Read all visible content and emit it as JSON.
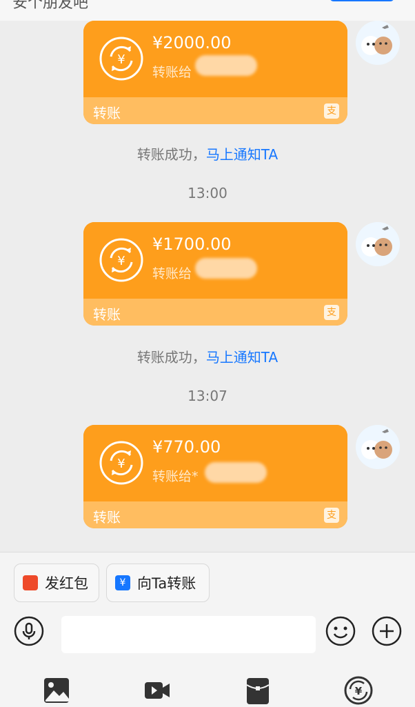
{
  "header": {
    "partial_text": "安个朋友吧"
  },
  "messages": [
    {
      "amount": "¥2000.00",
      "to": "转账给",
      "label": "转账",
      "notice": "转账成功，",
      "notice_link": "马上通知TA"
    },
    {
      "time": "13:00",
      "amount": "¥1700.00",
      "to": "转账给",
      "label": "转账",
      "notice": "转账成功，",
      "notice_link": "马上通知TA"
    },
    {
      "time": "13:07",
      "amount": "¥770.00",
      "to": "转账给*",
      "label": "转账"
    }
  ],
  "quick_actions": [
    {
      "label": "发红包",
      "icon": "red-packet-icon",
      "color": "#ee4a2a"
    },
    {
      "label": "向Ta转账",
      "icon": "transfer-icon",
      "color": "#1677ff"
    }
  ],
  "input": {
    "placeholder": ""
  },
  "toolbar": [
    "voice-icon",
    "emoji-icon",
    "plus-icon",
    "image-icon",
    "video-icon",
    "red-envelope-icon",
    "transfer-money-icon"
  ],
  "colors": {
    "card": "#fe9e1c",
    "card_bottom": "#ffbd60",
    "link": "#1677ff",
    "background": "#ededed"
  },
  "card_icon": "alipay-icon"
}
